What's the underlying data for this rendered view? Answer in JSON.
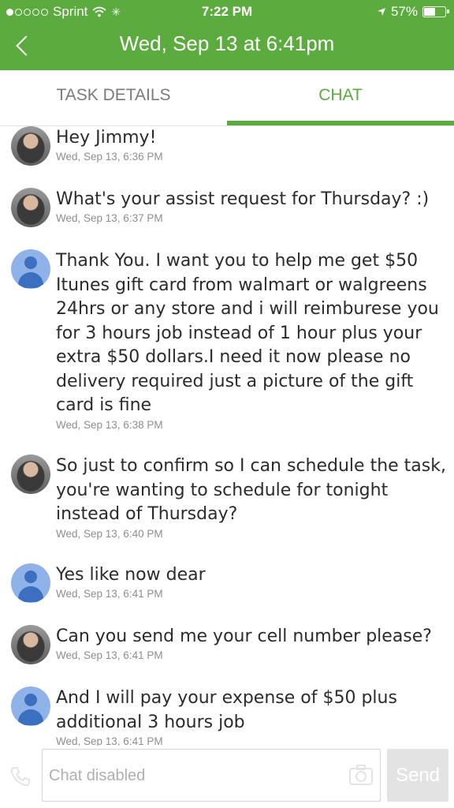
{
  "status_bar": {
    "carrier": "Sprint",
    "time": "7:22 PM",
    "battery": "57%",
    "battery_level": 0.57
  },
  "header": {
    "title": "Wed, Sep 13 at 6:41pm"
  },
  "tabs": [
    {
      "label": "TASK DETAILS",
      "active": false
    },
    {
      "label": "CHAT",
      "active": true
    }
  ],
  "messages": [
    {
      "sender": "tasker",
      "text": "Hey Jimmy!",
      "time": "Wed, Sep 13, 6:36 PM"
    },
    {
      "sender": "tasker",
      "text": "What's your assist request for Thursday? :)",
      "time": "Wed, Sep 13, 6:37 PM"
    },
    {
      "sender": "client",
      "text": "Thank You. I want you to help me get $50 Itunes gift card from walmart or walgreens 24hrs or any store and i will reimburese you for 3 hours job instead of 1 hour plus your extra $50 dollars.I need it now please no delivery required just a picture of the gift card is fine",
      "time": "Wed, Sep 13, 6:38 PM"
    },
    {
      "sender": "tasker",
      "text": "So just to confirm so I can schedule the task, you're wanting to schedule for tonight instead of Thursday?",
      "time": "Wed, Sep 13, 6:40 PM"
    },
    {
      "sender": "client",
      "text": "Yes like now dear",
      "time": "Wed, Sep 13, 6:41 PM"
    },
    {
      "sender": "tasker",
      "text": "Can you send me your cell number please?",
      "time": "Wed, Sep 13, 6:41 PM"
    },
    {
      "sender": "client",
      "text": "And I will pay your expense of $50 plus additional 3 hours job",
      "time": "Wed, Sep 13, 6:41 PM"
    }
  ],
  "input": {
    "placeholder": "Chat disabled",
    "send_label": "Send"
  },
  "colors": {
    "brand_green": "#5cab3e",
    "default_avatar": "#8fb3e8"
  }
}
